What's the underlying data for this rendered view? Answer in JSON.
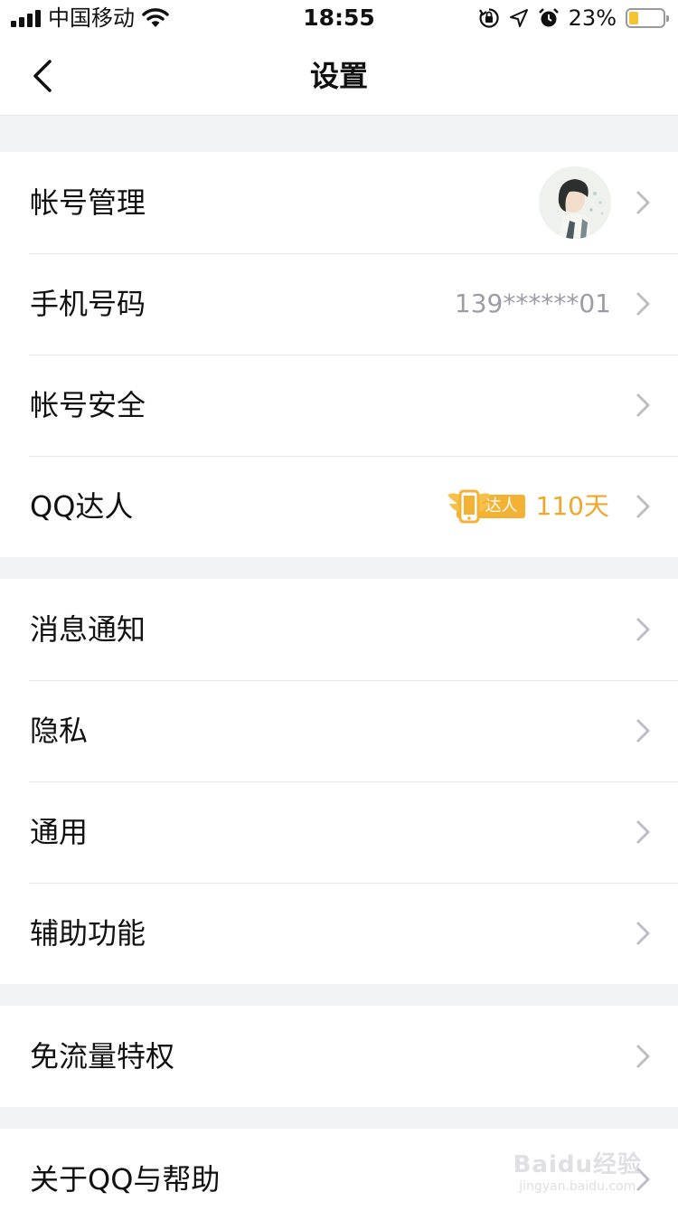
{
  "status_bar": {
    "carrier": "中国移动",
    "time": "18:55",
    "battery_percent": "23%",
    "battery_level": 0.23,
    "icons": [
      "signal-icon",
      "wifi-icon",
      "orientation-lock-icon",
      "location-icon",
      "alarm-icon",
      "battery-icon"
    ]
  },
  "nav": {
    "title": "设置",
    "back_icon": "chevron-left-icon"
  },
  "groups": [
    {
      "rows": [
        {
          "label": "帐号管理",
          "trailing": "avatar"
        },
        {
          "label": "手机号码",
          "value": "139******01"
        },
        {
          "label": "帐号安全"
        },
        {
          "label": "QQ达人",
          "badge": "达人",
          "days": "110天"
        }
      ]
    },
    {
      "rows": [
        {
          "label": "消息通知"
        },
        {
          "label": "隐私"
        },
        {
          "label": "通用"
        },
        {
          "label": "辅助功能"
        }
      ]
    },
    {
      "rows": [
        {
          "label": "免流量特权"
        }
      ]
    },
    {
      "rows": [
        {
          "label": "关于QQ与帮助"
        }
      ]
    }
  ],
  "colors": {
    "background": "#f2f3f7",
    "row_background": "#ffffff",
    "separator": "#e6e6ea",
    "value_gray": "#9c9ca6",
    "chevron_gray": "#bcbcc4",
    "daren_orange": "#f3b233",
    "battery_yellow": "#f6c433"
  },
  "watermark": {
    "logo": "Baidu经验",
    "url": "jingyan.baidu.com"
  }
}
